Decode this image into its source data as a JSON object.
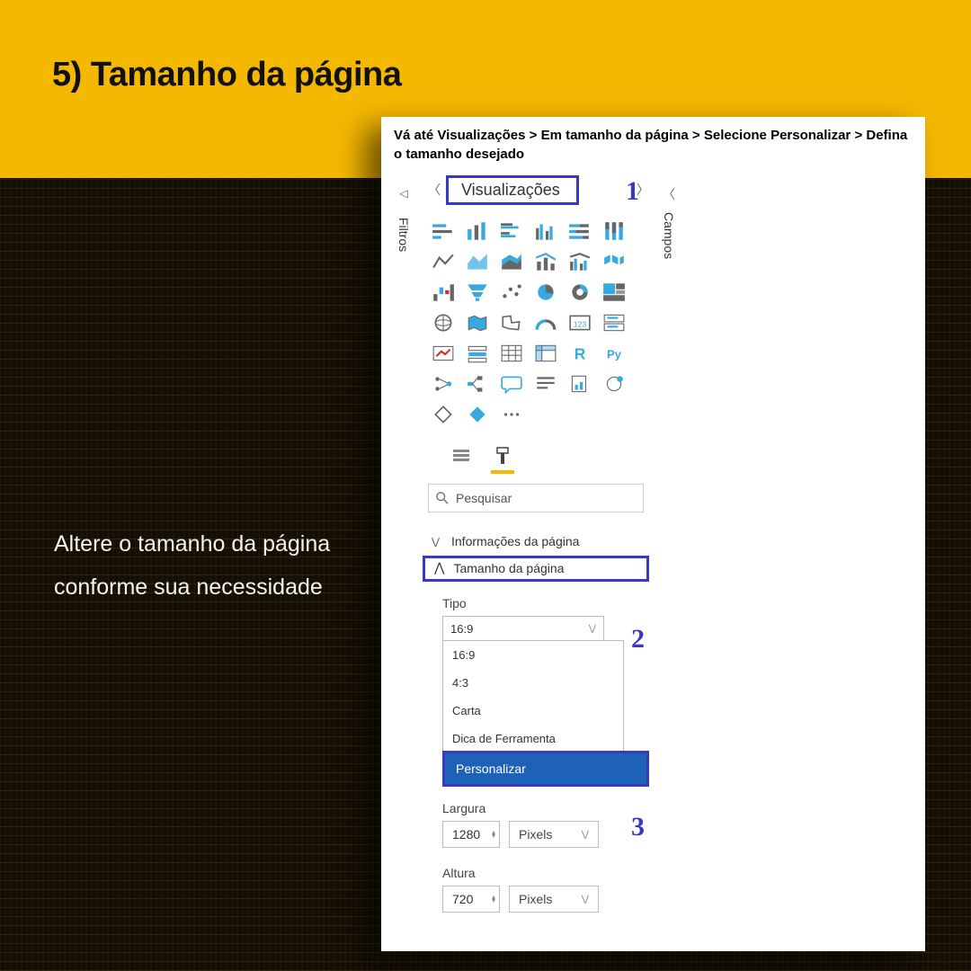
{
  "title": "5) Tamanho da página",
  "description": "Altere o tamanho da página conforme sua necessidade",
  "instruction": "Vá até Visualizações > Em tamanho da página > Selecione Personalizar > Defina o tamanho desejado",
  "sidetabs": {
    "filters": "Filtros",
    "fields": "Campos"
  },
  "panel": {
    "title": "Visualizações",
    "search_placeholder": "Pesquisar",
    "accordion_info": "Informações da página",
    "accordion_size": "Tamanho da página"
  },
  "callouts": {
    "one": "1",
    "two": "2",
    "three": "3"
  },
  "type_field": {
    "label": "Tipo",
    "selected": "16:9",
    "options": [
      "16:9",
      "4:3",
      "Carta",
      "Dica de Ferramenta",
      "Personalizar"
    ]
  },
  "width_field": {
    "label": "Largura",
    "value": "1280",
    "unit": "Pixels"
  },
  "height_field": {
    "label": "Altura",
    "value": "720",
    "unit": "Pixels"
  }
}
